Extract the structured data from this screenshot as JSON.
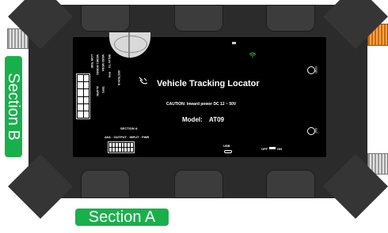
{
  "device": {
    "title": "Vehicle Tracking Locator",
    "caution": "CAUTION: Inward power DC 12 ~ 50V",
    "model_label": "Model:",
    "model_value": "AT09",
    "section_a_small": "SECTION A",
    "ports_label": "AN1 · OUTPUT · INPUT · PWR",
    "usb_label": "USB",
    "off_label": "OFF",
    "on_label": "ON",
    "gnd_label": "GND",
    "sat_label": "SAT",
    "vertical_labels": [
      "LOW TIME",
      "MODE1 MODE2",
      "MOD3 MOD4",
      "RELAY TX",
      "PFH",
      "ALARM",
      "TRFC",
      "SECTION B"
    ]
  },
  "annotations": {
    "section_a": "Section A",
    "section_b": "Section B"
  },
  "colors": {
    "label_green": "#19b04b",
    "housing": "#2b2b2b",
    "panel": "#000000",
    "orange_port": "#f5a54a"
  },
  "icons": [
    "satellite-icon",
    "wifi-icon",
    "globe-icon"
  ]
}
